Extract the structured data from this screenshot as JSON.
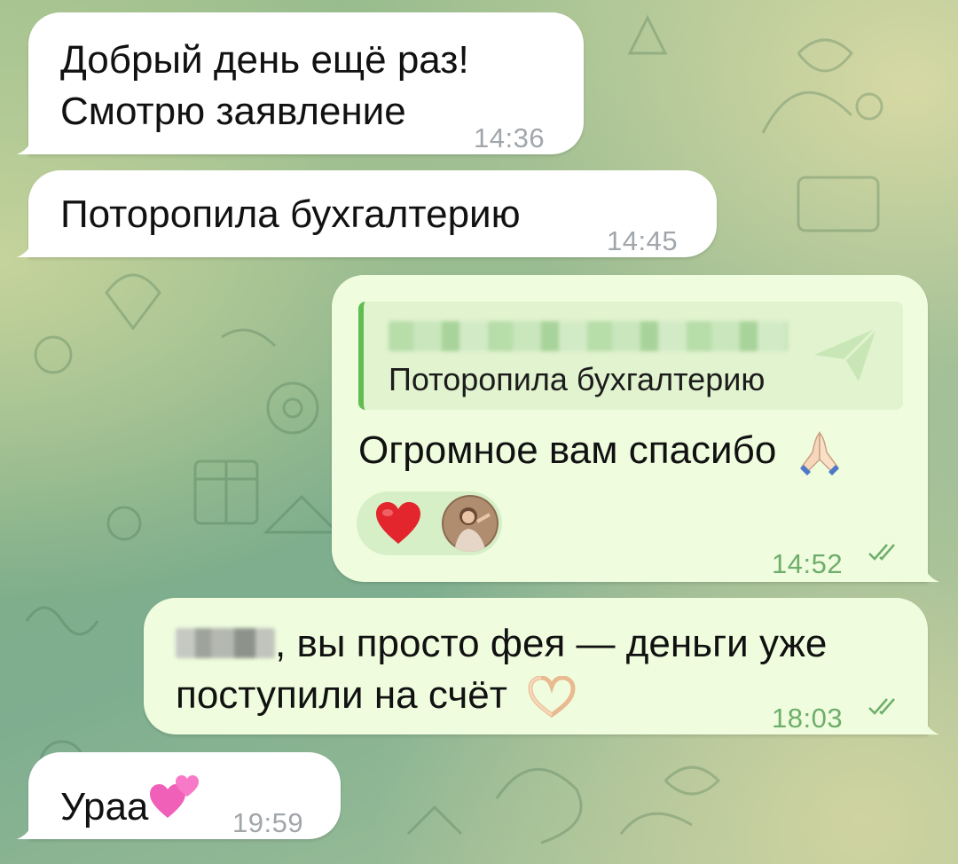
{
  "messages": [
    {
      "direction": "incoming",
      "lines": [
        "Добрый день ещё раз!",
        "Смотрю заявление"
      ],
      "time": "14:36"
    },
    {
      "direction": "incoming",
      "text": "Поторопила бухгалтерию",
      "time": "14:45"
    },
    {
      "direction": "outgoing",
      "reply_quote": "Поторопила бухгалтерию",
      "text": "Огромное вам спасибо",
      "emoji": "folded-hands",
      "reactions": [
        "red-heart",
        "user-avatar"
      ],
      "time": "14:52",
      "status": "read"
    },
    {
      "direction": "outgoing",
      "line1_rest": ", вы просто фея — деньги уже",
      "line2": "поступили на счёт",
      "emoji": "heart-hands",
      "time": "18:03",
      "status": "read"
    },
    {
      "direction": "incoming",
      "text": "Ураа",
      "emoji": "two-hearts",
      "time": "19:59"
    }
  ],
  "colors": {
    "incoming_bubble": "#ffffff",
    "outgoing_bubble": "#effdde",
    "outgoing_time": "#6eae6a",
    "incoming_time": "#a1a6ab",
    "reply_accent": "#5fbe4f"
  }
}
